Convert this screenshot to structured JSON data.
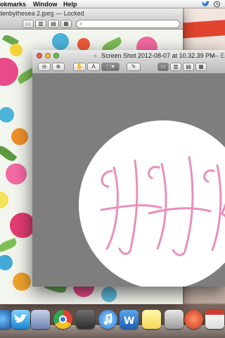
{
  "menubar": {
    "items": [
      "okmarks",
      "Window",
      "Help"
    ],
    "tray_icons": [
      "twitter-icon",
      "time-machine-icon"
    ]
  },
  "back_window": {
    "title": "denbythesea 2.jpeg  —  Locked",
    "search_placeholder": ""
  },
  "front_window": {
    "title": "Screen Shot 2012-08-07 at 10.32.39 PM",
    "title_suffix": "— Ed",
    "monogram": "HHK",
    "colors": {
      "monogram": "#e98fbc",
      "canvas": "#7e7e7e",
      "circle": "#ffffff"
    }
  },
  "dock": {
    "apps": [
      "finder",
      "twitter",
      "chrome",
      "iphoto",
      "itunes",
      "word",
      "stickies",
      "preview",
      "photo-booth",
      "calendar"
    ]
  }
}
